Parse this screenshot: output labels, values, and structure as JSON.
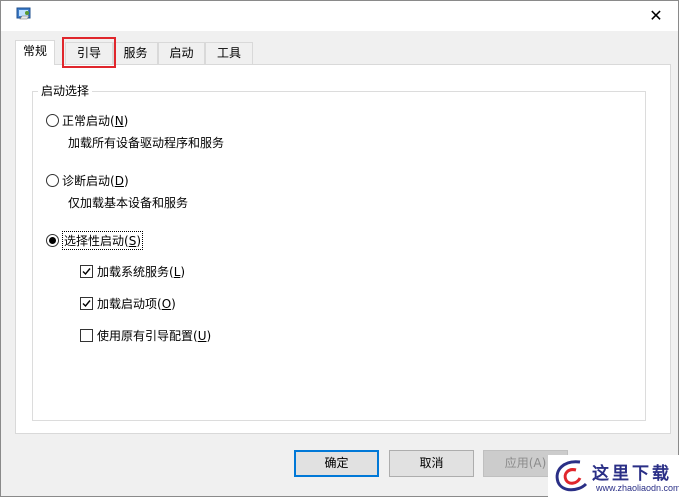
{
  "window": {
    "close_glyph": "✕"
  },
  "tabs": [
    {
      "label": "常规",
      "active": true
    },
    {
      "label": "引导",
      "active": false
    },
    {
      "label": "服务",
      "active": false
    },
    {
      "label": "启动",
      "active": false
    },
    {
      "label": "工具",
      "active": false
    }
  ],
  "startup_group": {
    "title": "启动选择",
    "normal": {
      "label": "正常启动(",
      "accel": "N",
      "tail": ")",
      "selected": false,
      "description": "加载所有设备驱动程序和服务"
    },
    "diagnostic": {
      "label": "诊断启动(",
      "accel": "D",
      "tail": ")",
      "selected": false,
      "description": "仅加载基本设备和服务"
    },
    "selective": {
      "label": "选择性启动(",
      "accel": "S",
      "tail": ")",
      "selected": true
    },
    "options": [
      {
        "label": "加载系统服务(",
        "accel": "L",
        "tail": ")",
        "checked": true
      },
      {
        "label": "加载启动项(",
        "accel": "O",
        "tail": ")",
        "checked": true
      },
      {
        "label": "使用原有引导配置(",
        "accel": "U",
        "tail": ")",
        "checked": false
      }
    ]
  },
  "buttons": {
    "ok": "确定",
    "cancel": "取消",
    "apply": "应用(A)"
  },
  "watermark": {
    "title": "这里下载",
    "url": "www.zhaoliaodn.com"
  },
  "colors": {
    "highlight": "#e0262c",
    "default_button_border": "#0078d7",
    "watermark": "#2a2f86"
  }
}
